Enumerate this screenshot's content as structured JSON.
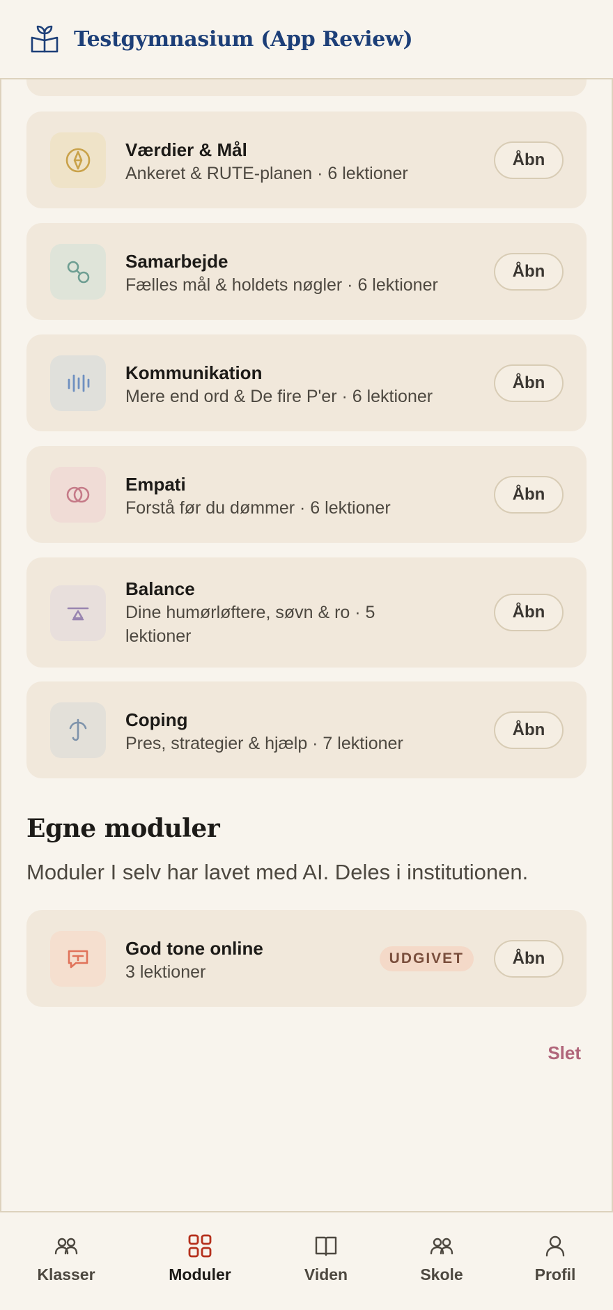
{
  "header": {
    "title": "Testgymnasium (App Review)",
    "logo_icon": "open-book-plant-icon"
  },
  "modules": [
    {
      "name": "Værdier & Mål",
      "description": "Ankeret & RUTE-planen · 6 lektioner",
      "icon": "compass-icon",
      "icon_color": "#c9a24a",
      "icon_bg": "#efe3c8",
      "action": "Åbn"
    },
    {
      "name": "Samarbejde",
      "description": "Fælles mål & holdets nøgler · 6 lektioner",
      "icon": "link-circles-icon",
      "icon_color": "#6e9e92",
      "icon_bg": "#dfe4d9",
      "action": "Åbn"
    },
    {
      "name": "Kommunikation",
      "description": "Mere end ord & De fire P'er · 6 lektioner",
      "icon": "sound-wave-icon",
      "icon_color": "#6f90c0",
      "icon_bg": "#e0e0db",
      "action": "Åbn"
    },
    {
      "name": "Empati",
      "description": "Forstå før du dømmer · 6 lektioner",
      "icon": "overlapping-rings-icon",
      "icon_color": "#c57a88",
      "icon_bg": "#f0dcd6",
      "action": "Åbn"
    },
    {
      "name": "Balance",
      "description": "Dine humørløftere, søvn & ro · 5 lektioner",
      "icon": "balance-icon",
      "icon_color": "#9985b0",
      "icon_bg": "#e8dfdc",
      "action": "Åbn"
    },
    {
      "name": "Coping",
      "description": "Pres, strategier & hjælp · 7 lektioner",
      "icon": "hook-icon",
      "icon_color": "#7e93ab",
      "icon_bg": "#e3e0d9",
      "action": "Åbn"
    }
  ],
  "own_modules": {
    "title": "Egne moduler",
    "subtitle": "Moduler I selv har lavet med AI. Deles i institutionen.",
    "items": [
      {
        "name": "God tone online",
        "description": "3 lektioner",
        "badge": "UDGIVET",
        "icon": "chat-bubble-icon",
        "icon_color": "#e0735a",
        "icon_bg": "#f5dfcf",
        "action": "Åbn"
      }
    ],
    "delete_label": "Slet"
  },
  "nav": {
    "active": "Moduler",
    "items": [
      {
        "label": "Klasser",
        "icon": "people-icon"
      },
      {
        "label": "Moduler",
        "icon": "grid-icon"
      },
      {
        "label": "Viden",
        "icon": "book-icon"
      },
      {
        "label": "Skole",
        "icon": "people-icon"
      },
      {
        "label": "Profil",
        "icon": "person-icon"
      }
    ]
  },
  "colors": {
    "accent": "#b5301c",
    "brand": "#1d3f78",
    "background": "#f8f4ed",
    "card": "#f1e8db"
  }
}
